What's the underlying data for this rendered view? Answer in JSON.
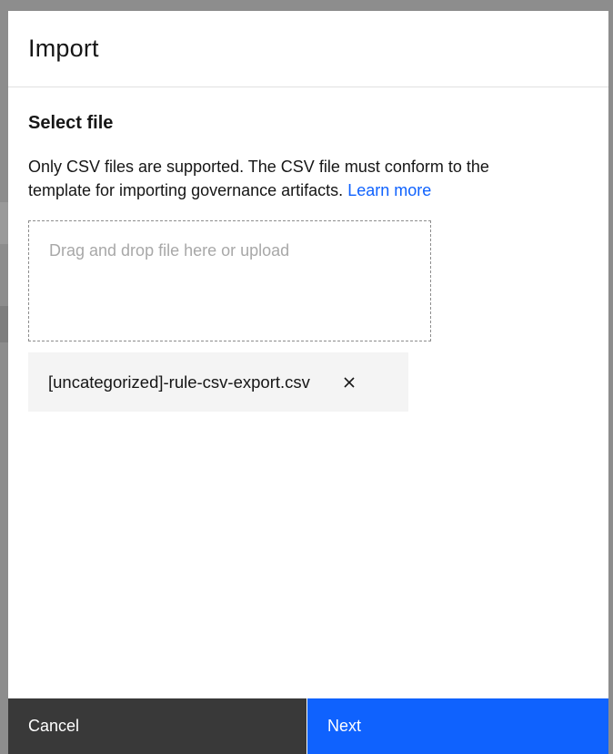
{
  "dialog": {
    "title": "Import"
  },
  "body": {
    "section_title": "Select file",
    "description": "Only CSV files are supported. The CSV file must conform to the template for importing governance artifacts.",
    "learn_more_label": "Learn more"
  },
  "dropzone": {
    "text": "Drag and drop file here or upload"
  },
  "file": {
    "name": "[uncategorized]-rule-csv-export.csv",
    "remove_icon": "close-icon"
  },
  "footer": {
    "cancel_label": "Cancel",
    "next_label": "Next"
  },
  "colors": {
    "primary": "#0f62fe",
    "secondary": "#393939",
    "scrim": "#8d8d8d"
  }
}
